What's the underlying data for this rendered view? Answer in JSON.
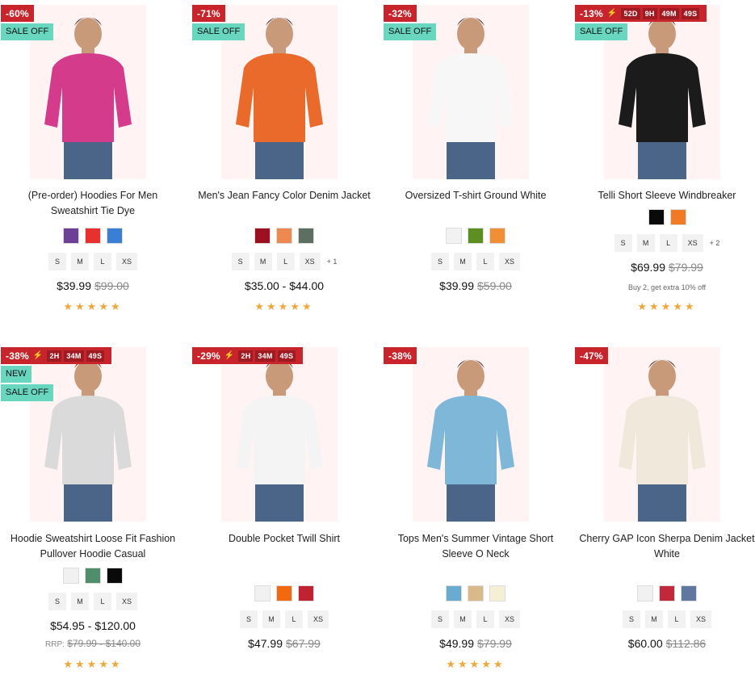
{
  "products": [
    {
      "discount": "-60%",
      "timer": null,
      "tags": [
        "SALE OFF"
      ],
      "title_lines": [
        "(Pre-order) Hoodies For Men",
        "Sweatshirt Tie Dye"
      ],
      "colors": [
        "#6e3f97",
        "#e8302f",
        "#3b7fd4"
      ],
      "sizes": [
        "S",
        "M",
        "L",
        "XS"
      ],
      "more_sizes": "",
      "price": "$39.99",
      "old_price": "$99.00",
      "note": "",
      "rrp_label": "",
      "rrp_value": "",
      "rating": "★★★★★",
      "image_desc": "tie-dye hoodie",
      "shirt_color": "#d43b8a"
    },
    {
      "discount": "-71%",
      "timer": null,
      "tags": [
        "SALE OFF"
      ],
      "title_lines": [
        "Men's Jean Fancy Color Denim Jacket",
        ""
      ],
      "colors": [
        "#9c1020",
        "#ec8a52",
        "#5c6f61"
      ],
      "sizes": [
        "S",
        "M",
        "L",
        "XS"
      ],
      "more_sizes": "+ 1",
      "price": "$35.00 - $44.00",
      "old_price": "",
      "note": "",
      "rrp_label": "",
      "rrp_value": "",
      "rating": "★★★★★",
      "shirt_color": "#e96a2a"
    },
    {
      "discount": "-32%",
      "timer": null,
      "tags": [
        "SALE OFF"
      ],
      "title_lines": [
        "Oversized T-shirt Ground White",
        ""
      ],
      "colors": [
        "#f2f2f2",
        "#5d8e22",
        "#f28f35"
      ],
      "sizes": [
        "S",
        "M",
        "L",
        "XS"
      ],
      "more_sizes": "",
      "price": "$39.99",
      "old_price": "$59.00",
      "note": "",
      "rrp_label": "",
      "rrp_value": "",
      "rating": "",
      "shirt_color": "#f7f7f7"
    },
    {
      "discount": "-13%",
      "timer": [
        {
          "n": "52",
          "u": "D"
        },
        {
          "n": "9",
          "u": "H"
        },
        {
          "n": "49",
          "u": "M"
        },
        {
          "n": "49",
          "u": "S"
        }
      ],
      "tags": [
        "SALE OFF"
      ],
      "title_lines": [
        "Telli Short Sleeve Windbreaker",
        ""
      ],
      "colors": [
        "#0a0a0a",
        "#f27a24"
      ],
      "sizes": [
        "S",
        "M",
        "L",
        "XS"
      ],
      "more_sizes": "+ 2",
      "price": "$69.99",
      "old_price": "$79.99",
      "note": "Buy 2, get extra 10% off",
      "rrp_label": "",
      "rrp_value": "",
      "rating": "★★★★★",
      "shirt_color": "#1b1b1b"
    },
    {
      "discount": "-38%",
      "timer": [
        {
          "n": "2",
          "u": "H"
        },
        {
          "n": "34",
          "u": "M"
        },
        {
          "n": "49",
          "u": "S"
        }
      ],
      "tags": [
        "NEW",
        "SALE OFF"
      ],
      "title_lines": [
        "Hoodie Sweatshirt Loose Fit Fashion",
        "Pullover Hoodie Casual"
      ],
      "colors": [
        "#f1f1f1",
        "#4f8d6b",
        "#0a0a0a"
      ],
      "sizes": [
        "S",
        "M",
        "L",
        "XS"
      ],
      "more_sizes": "",
      "price": "$54.95 - $120.00",
      "old_price": "",
      "note": "",
      "rrp_label": "RRP:",
      "rrp_value": "$79.99 - $140.00",
      "rating": "★★★★★",
      "shirt_color": "#dadada"
    },
    {
      "discount": "-29%",
      "timer": [
        {
          "n": "2",
          "u": "H"
        },
        {
          "n": "34",
          "u": "M"
        },
        {
          "n": "49",
          "u": "S"
        }
      ],
      "tags": [],
      "title_lines": [
        "Double Pocket Twill Shirt",
        ""
      ],
      "colors": [
        "#f1f1f1",
        "#f2690f",
        "#bf2231"
      ],
      "sizes": [
        "S",
        "M",
        "L",
        "XS"
      ],
      "more_sizes": "",
      "price": "$47.99",
      "old_price": "$67.99",
      "note": "",
      "rrp_label": "",
      "rrp_value": "",
      "rating": "",
      "shirt_color": "#f4f4f4"
    },
    {
      "discount": "-38%",
      "timer": null,
      "tags": [],
      "title_lines": [
        "Tops Men's Summer Vintage Short",
        "Sleeve O Neck"
      ],
      "colors": [
        "#6aacd0",
        "#d7b98a",
        "#f5efd6"
      ],
      "sizes": [
        "S",
        "M",
        "L",
        "XS"
      ],
      "more_sizes": "",
      "price": "$49.99",
      "old_price": "$79.99",
      "note": "",
      "rrp_label": "",
      "rrp_value": "",
      "rating": "★★★★★",
      "shirt_color": "#7fb7d9"
    },
    {
      "discount": "-47%",
      "timer": null,
      "tags": [],
      "title_lines": [
        "Cherry GAP Icon Sherpa Denim Jacket",
        "White"
      ],
      "colors": [
        "#f1f1f1",
        "#c3283a",
        "#6077a0"
      ],
      "sizes": [
        "S",
        "M",
        "L",
        "XS"
      ],
      "more_sizes": "",
      "price": "$60.00",
      "old_price": "$112.86",
      "note": "",
      "rrp_label": "",
      "rrp_value": "",
      "rating": "",
      "shirt_color": "#efe8db"
    }
  ]
}
